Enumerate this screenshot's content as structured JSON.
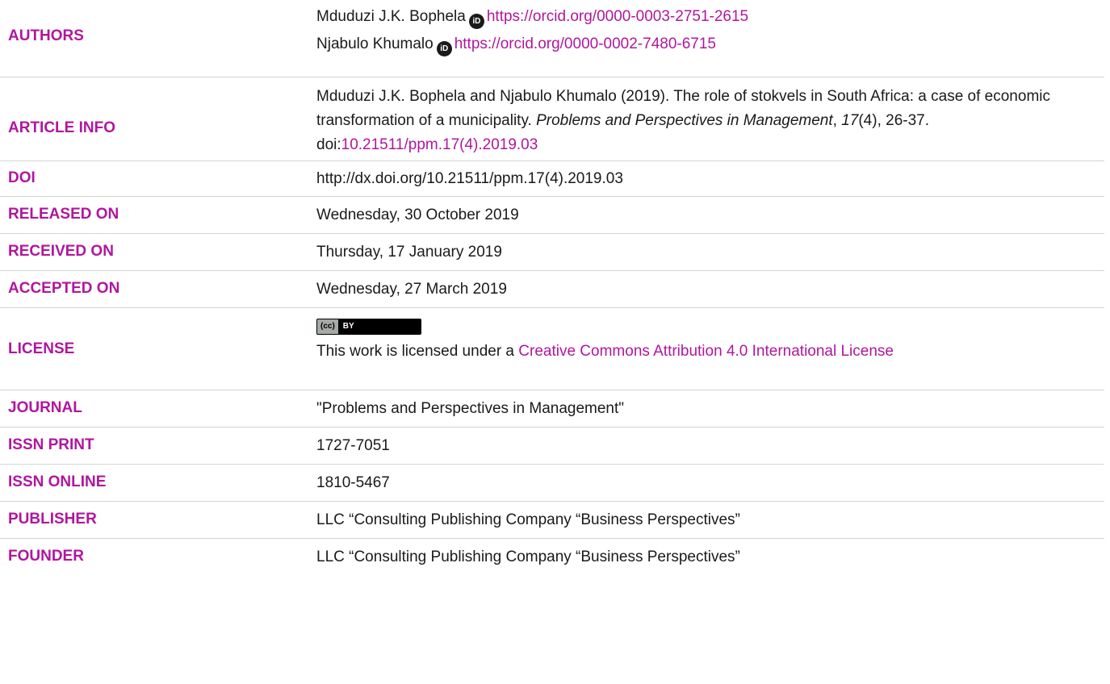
{
  "authors": {
    "label": "AUTHORS",
    "items": [
      {
        "name": "Mduduzi J.K. Bophela",
        "orcid": "https://orcid.org/0000-0003-2751-2615"
      },
      {
        "name": "Njabulo Khumalo",
        "orcid": "https://orcid.org/0000-0002-7480-6715"
      }
    ]
  },
  "article_info": {
    "label": "ARTICLE INFO",
    "citation_prefix": "Mduduzi J.K. Bophela and Njabulo Khumalo (2019). The role of stokvels in South Africa: a case of economic transformation of a municipality. ",
    "journal_italic": "Problems and Perspectives in Management",
    "volume_italic": "17",
    "issue_pages": "(4), 26-37. doi:",
    "doi_link": "10.21511/ppm.17(4).2019.03"
  },
  "doi": {
    "label": "DOI",
    "value": "http://dx.doi.org/10.21511/ppm.17(4).2019.03"
  },
  "released": {
    "label": "RELEASED ON",
    "value": "Wednesday, 30 October 2019"
  },
  "received": {
    "label": "RECEIVED ON",
    "value": "Thursday, 17 January 2019"
  },
  "accepted": {
    "label": "ACCEPTED ON",
    "value": "Wednesday, 27 March 2019"
  },
  "license": {
    "label": "LICENSE",
    "badge_cc": "(cc)",
    "badge_by": "BY",
    "text_prefix": "This work is licensed under a ",
    "link_text": "Creative Commons Attribution 4.0 International License"
  },
  "journal": {
    "label": "JOURNAL",
    "value": "\"Problems and Perspectives in Management\""
  },
  "issn_print": {
    "label": "ISSN PRINT",
    "value": "1727-7051"
  },
  "issn_online": {
    "label": "ISSN ONLINE",
    "value": "1810-5467"
  },
  "publisher": {
    "label": "PUBLISHER",
    "value": "LLC “Consulting Publishing Company “Business Perspectives”"
  },
  "founder": {
    "label": "FOUNDER",
    "value": "LLC “Consulting Publishing Company “Business Perspectives”"
  },
  "colors": {
    "accent": "#b0169e",
    "text": "#1a1a1a",
    "divider": "#d4d4d4"
  },
  "icons": {
    "orcid": "orcid-icon",
    "cc": "cc-by-badge"
  }
}
